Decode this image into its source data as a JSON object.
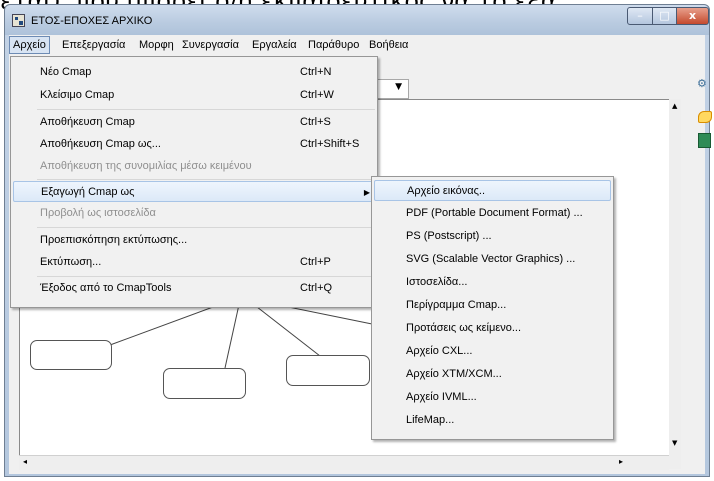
{
  "top_text": "εται), που μπορει ο/η εκπαιδευτικος να το εξα",
  "window": {
    "title": "ΕΤΟΣ-ΕΠΟΧΕΣ ΑΡΧΙΚΟ",
    "minimize": "–",
    "maximize": "□",
    "close": "x"
  },
  "menubar": {
    "items": [
      "Αρχείο",
      "Επεξεργασία",
      "Μορφη",
      "Συνεργασία",
      "Εργαλεία",
      "Παράθυρο",
      "Βοήθεια"
    ]
  },
  "file_menu": {
    "items": [
      {
        "label": "Νέο Cmap",
        "accel": "Ctrl+N"
      },
      {
        "label": "Κλείσιμο Cmap",
        "accel": "Ctrl+W"
      },
      {
        "label": "Αποθήκευση Cmap",
        "accel": "Ctrl+S"
      },
      {
        "label": "Αποθήκευση Cmap ως...",
        "accel": "Ctrl+Shift+S"
      },
      {
        "label": "Αποθήκευση της συνομιλίας μέσω κειμένου",
        "accel": ""
      },
      {
        "label": "Εξαγωγή Cmap ως",
        "accel": ""
      },
      {
        "label": "Προβολή ως ιστοσελίδα",
        "accel": ""
      },
      {
        "label": "Προεπισκόπηση εκτύπωσης...",
        "accel": ""
      },
      {
        "label": "Εκτύπωση...",
        "accel": "Ctrl+P"
      },
      {
        "label": "Έξοδος από το CmapTools",
        "accel": "Ctrl+Q"
      }
    ]
  },
  "export_submenu": {
    "items": [
      "Αρχείο εικόνας..",
      "PDF (Portable Document Format) ...",
      "PS (Postscript) ...",
      "SVG (Scalable Vector Graphics) ...",
      "Ιστοσελίδα...",
      "Περίγραμμα Cmap...",
      "Προτάσεις ως κείμενο...",
      "Αρχείο CXL...",
      "Αρχείο XTM/XCM...",
      "Αρχείο IVML...",
      "LifeMap..."
    ]
  },
  "icons": {
    "app": "cmap-app-icon",
    "tools": [
      "connect-icon",
      "paint-icon",
      "book-icon"
    ]
  },
  "colors": {
    "highlight": "#dce9f8",
    "menu_bg": "#f1f1f1",
    "disabled_text": "#8f8f8f"
  }
}
